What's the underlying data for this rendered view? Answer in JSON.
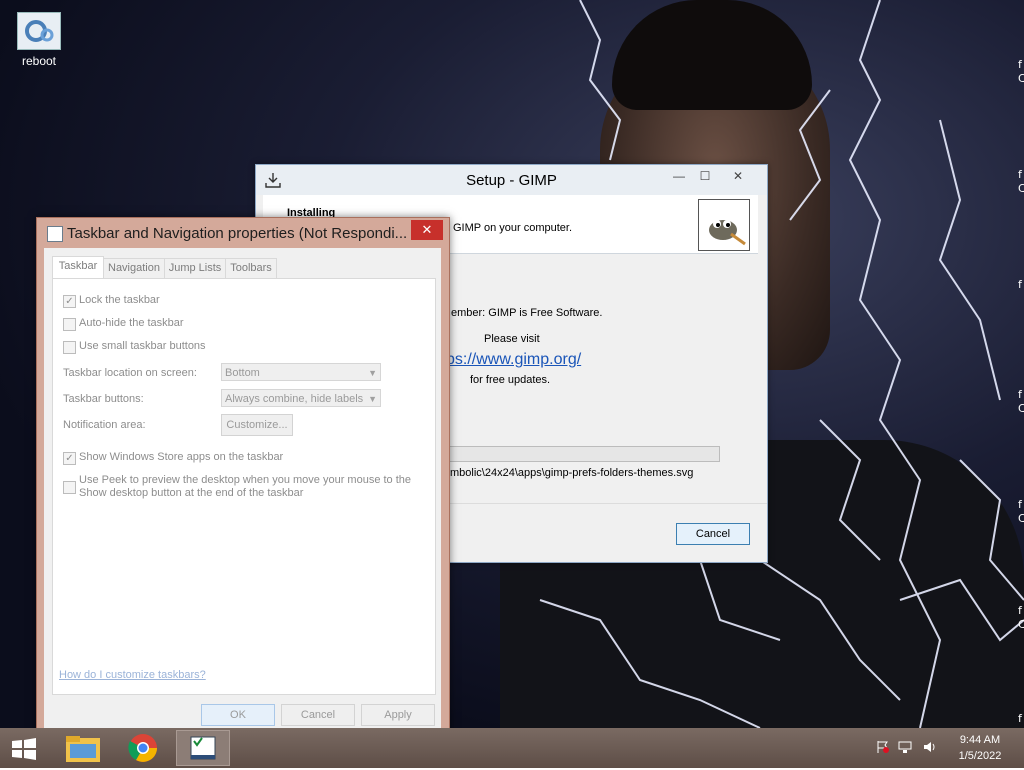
{
  "desktop": {
    "icons": [
      {
        "label": "reboot",
        "icon": "gear-icon"
      }
    ],
    "edge_letters": [
      "f",
      "C",
      "f",
      "C",
      "f",
      "f",
      "C",
      "f",
      "C",
      "f",
      "C",
      "f"
    ]
  },
  "gimp_setup": {
    "title": "Setup - GIMP",
    "heading": "Installing",
    "subheading": "GIMP on your computer.",
    "remember": "ember: GIMP is Free Software.",
    "please_visit": "Please visit",
    "link": "ps://www.gimp.org/",
    "updates": "for free updates.",
    "progress": 0.0,
    "current_file": "mbolic\\24x24\\apps\\gimp-prefs-folders-themes.svg",
    "cancel_label": "Cancel",
    "minimize": "—",
    "restore": "☐",
    "close": "✕"
  },
  "props": {
    "title": "Taskbar and Navigation properties (Not Respondi...",
    "close": "✕",
    "tabs": [
      "Taskbar",
      "Navigation",
      "Jump Lists",
      "Toolbars"
    ],
    "lock_taskbar": "Lock the taskbar",
    "auto_hide": "Auto-hide the taskbar",
    "small_buttons": "Use small taskbar buttons",
    "location_label": "Taskbar location on screen:",
    "location_value": "Bottom",
    "buttons_label": "Taskbar buttons:",
    "buttons_value": "Always combine, hide labels",
    "notification_label": "Notification area:",
    "customize_label": "Customize...",
    "store_apps": "Show Windows Store apps on the taskbar",
    "peek_line1": "Use Peek to preview the desktop when you move your mouse to the",
    "peek_line2": "Show desktop button at the end of the taskbar",
    "help_link": "How do I customize taskbars?",
    "ok": "OK",
    "cancel": "Cancel",
    "apply": "Apply",
    "lock_checked": true,
    "store_checked": true,
    "check_mark": "✓"
  },
  "taskbar": {
    "time": "9:44 AM",
    "date": "1/5/2022",
    "apps": [
      "windows-start-icon",
      "file-explorer-icon",
      "chrome-icon",
      "taskbar-properties-icon"
    ]
  },
  "colors": {
    "accent_close": "#c7302b",
    "link": "#1a55b8",
    "window_border_unresponsive": "#d4a99a"
  }
}
